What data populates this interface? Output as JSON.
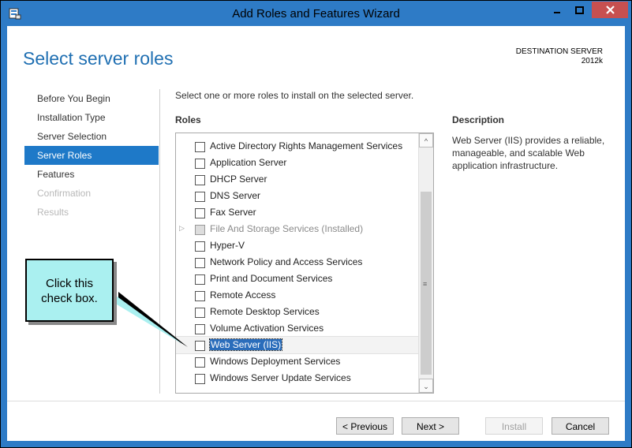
{
  "window": {
    "title": "Add Roles and Features Wizard"
  },
  "page": {
    "heading": "Select server roles",
    "destination_label": "DESTINATION SERVER",
    "destination_name": "2012k",
    "intro": "Select one or more roles to install on the selected server.",
    "roles_label": "Roles",
    "description_label": "Description",
    "description_text": "Web Server (IIS) provides a reliable, manageable, and scalable Web application infrastructure."
  },
  "nav": {
    "items": [
      {
        "label": "Before You Begin",
        "state": "normal"
      },
      {
        "label": "Installation Type",
        "state": "normal"
      },
      {
        "label": "Server Selection",
        "state": "normal"
      },
      {
        "label": "Server Roles",
        "state": "active"
      },
      {
        "label": "Features",
        "state": "normal"
      },
      {
        "label": "Confirmation",
        "state": "disabled"
      },
      {
        "label": "Results",
        "state": "disabled"
      }
    ]
  },
  "roles": [
    {
      "label": "Active Directory Rights Management Services",
      "checked": false
    },
    {
      "label": "Application Server",
      "checked": false
    },
    {
      "label": "DHCP Server",
      "checked": false
    },
    {
      "label": "DNS Server",
      "checked": false
    },
    {
      "label": "Fax Server",
      "checked": false
    },
    {
      "label": "File And Storage Services (Installed)",
      "checked": true,
      "installed": true
    },
    {
      "label": "Hyper-V",
      "checked": false
    },
    {
      "label": "Network Policy and Access Services",
      "checked": false
    },
    {
      "label": "Print and Document Services",
      "checked": false
    },
    {
      "label": "Remote Access",
      "checked": false
    },
    {
      "label": "Remote Desktop Services",
      "checked": false
    },
    {
      "label": "Volume Activation Services",
      "checked": false
    },
    {
      "label": "Web Server (IIS)",
      "checked": false,
      "selected": true
    },
    {
      "label": "Windows Deployment Services",
      "checked": false
    },
    {
      "label": "Windows Server Update Services",
      "checked": false
    }
  ],
  "buttons": {
    "previous": "< Previous",
    "next": "Next >",
    "install": "Install",
    "cancel": "Cancel"
  },
  "callout": {
    "line1": "Click this",
    "line2": "check box."
  },
  "colors": {
    "accent": "#1e79c8",
    "titlebar": "#2e7bc6",
    "heading": "#1f6fb2",
    "callout": "#aaf0f0"
  }
}
